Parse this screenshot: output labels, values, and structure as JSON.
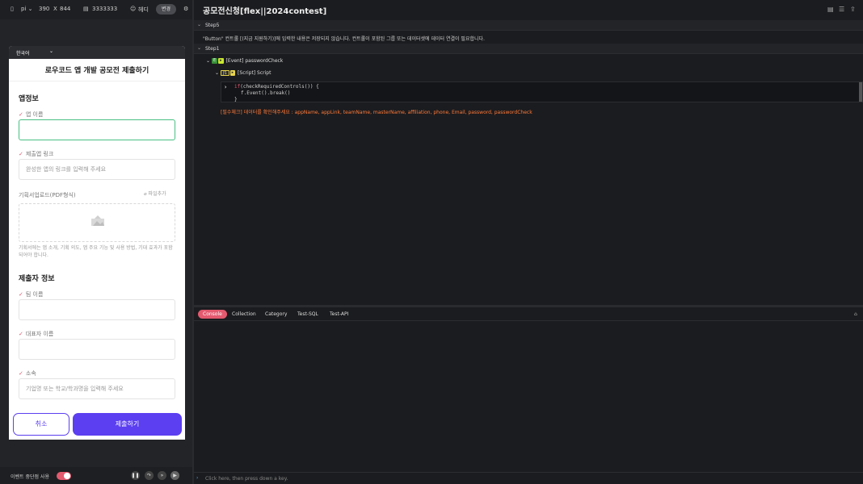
{
  "device_bar": {
    "device_label": "pi",
    "width": "390",
    "x_sep": "X",
    "height": "844",
    "code": "3333333",
    "user": "헤디",
    "change_label": "변경"
  },
  "device": {
    "language": "한국어",
    "title": "로우코드 앱 개발 공모전 제출하기",
    "section_app": "앱정보",
    "app_name_label": "앱 이름",
    "app_link_label": "제출앱 링크",
    "app_link_placeholder": "완성한 앱의 링크를 입력해 주세요",
    "plan_upload_label": "기획서업로드(PDF형식)",
    "file_add_label": "파일추가",
    "plan_hint": "기획서에는 앱 소개, 기획 의도, 앱 주요 기능 및 사용 방법, 기대 효과가 포함되어야 합니다.",
    "section_submitter": "제출자 정보",
    "team_name_label": "팀 이름",
    "master_name_label": "대표자 이름",
    "affiliation_label": "소속",
    "affiliation_placeholder": "기업명 또는 학교/학과명을 입력해 주세요",
    "cancel_label": "취소",
    "submit_label": "제출하기"
  },
  "bottom_bar": {
    "event_toggle_label": "이벤트 중단점 사용"
  },
  "editor": {
    "title": "공모전신청[flex||2024contest]",
    "step5_label": "Step5",
    "step5_warning": "\"Button\" 컨트롤 [(지금 지원하기)]에 입력한 내용은 저장되지 않습니다. 컨트롤이 포함된 그룹 또는 데이터셋에 데이터 연결이 필요합니다.",
    "step1_label": "Step1",
    "event_badge": "E",
    "event_node": "[Event] passwordCheck",
    "script_badge": "JS",
    "script_node": "[Script] Script",
    "code_line1_kw": "if",
    "code_line1_rest": "(checkRequiredControls()) {",
    "code_line2": "f.Event().break()",
    "code_line3": "}",
    "required_message": "[필수체크] 데이터를 확인해주세요 : appName, appLink, teamName, masterName, affiliation, phone, Email, password, passwordCheck"
  },
  "console": {
    "tabs": [
      "Console",
      "Collection",
      "Category",
      "Test-SQL",
      "Test-API"
    ],
    "input_placeholder": "Click here, then press down a key."
  },
  "colors": {
    "accent_purple": "#5b3ff0",
    "accent_pink": "#e35a6f",
    "active_field": "#48c083",
    "warning_orange": "#ff7a3a"
  }
}
